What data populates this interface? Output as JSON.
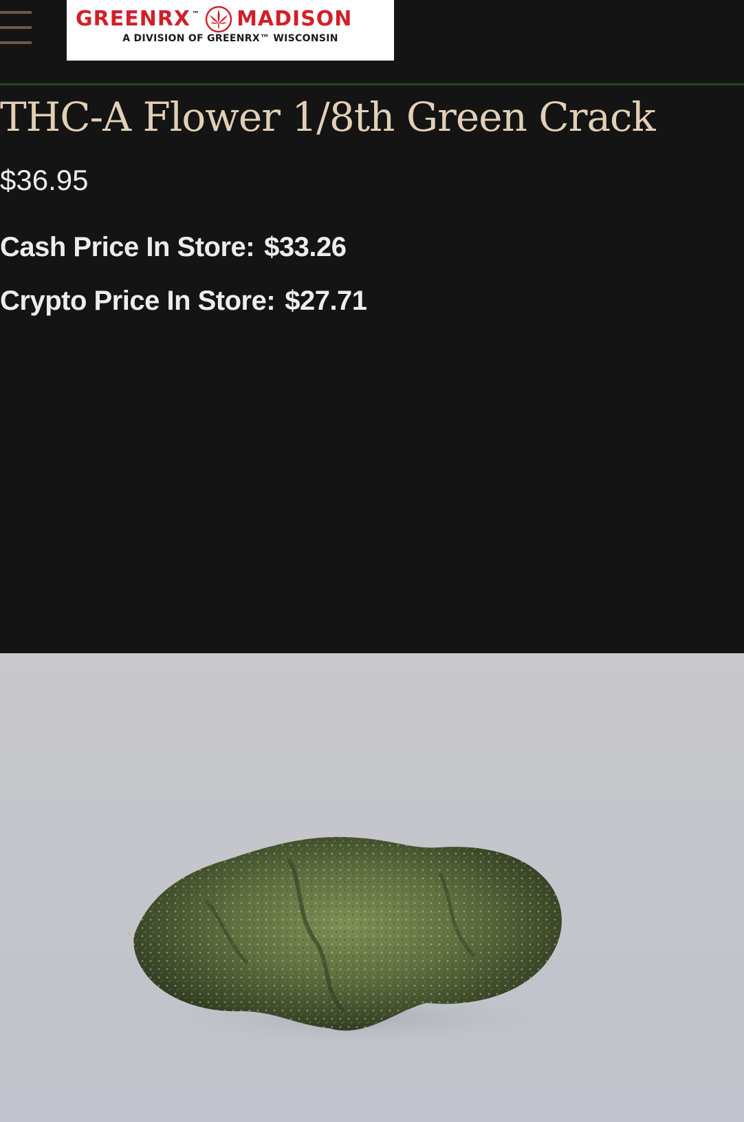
{
  "header": {
    "logo": {
      "brand_left": "GREENRX",
      "tm": "™",
      "brand_right": "MADISON",
      "subtitle": "A DIVISION OF GREENRX™ WISCONSIN"
    }
  },
  "product": {
    "title": "THC-A Flower 1/8th Green Crack",
    "price": "$36.95",
    "cash_label": "Cash Price In Store:",
    "cash_value": "$33.26",
    "crypto_label": "Crypto Price In Store:",
    "crypto_value": "$27.71"
  },
  "colors": {
    "background": "#141414",
    "title": "#e3cfb6",
    "logo_red": "#d0202a",
    "divider_green": "#1f4d1c"
  },
  "icons": {
    "menu": "hamburger-menu-icon",
    "logo_mark": "cannabis-leaf-icon"
  }
}
